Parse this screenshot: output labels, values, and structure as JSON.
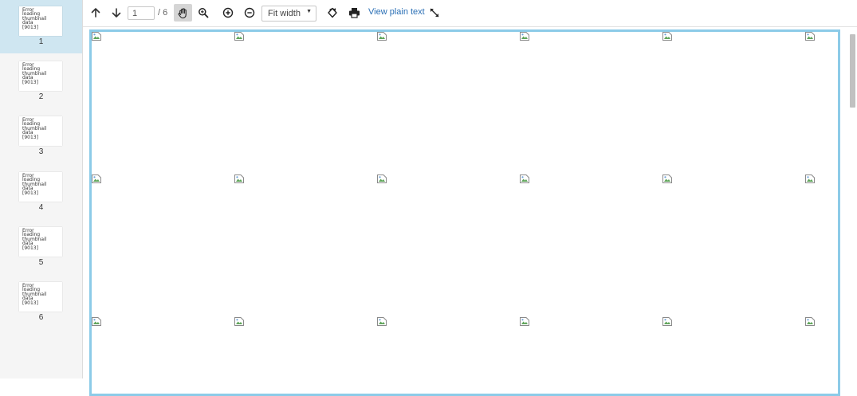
{
  "sidebar": {
    "thumbnails": [
      {
        "number": "1",
        "error_text": "Error loading thumbnail data [9013]",
        "active": true
      },
      {
        "number": "2",
        "error_text": "Error loading thumbnail data [9013]",
        "active": false
      },
      {
        "number": "3",
        "error_text": "Error loading thumbnail data [9013]",
        "active": false
      },
      {
        "number": "4",
        "error_text": "Error loading thumbnail data [9013]",
        "active": false
      },
      {
        "number": "5",
        "error_text": "Error loading thumbnail data [9013]",
        "active": false
      },
      {
        "number": "6",
        "error_text": "Error loading thumbnail data [9013]",
        "active": false
      }
    ]
  },
  "toolbar": {
    "prev_page_icon": "arrow-up-icon",
    "next_page_icon": "arrow-down-icon",
    "current_page": "1",
    "total_pages": "/ 6",
    "pan_tool_icon": "hand-icon",
    "zoom_tool_icon": "magnifier-icon",
    "zoom_in_icon": "plus-circle-icon",
    "zoom_out_icon": "minus-circle-icon",
    "zoom_value": "Fit width",
    "rotate_icon": "rotate-icon",
    "print_icon": "printer-icon",
    "view_plain_text": "View plain text",
    "fullscreen_icon": "expand-icon"
  },
  "colors": {
    "sidebar_bg": "#f5f5f5",
    "active_thumb_bg": "#cfe6f1",
    "page_border": "#8ccbe8",
    "link": "#2a6fb5"
  }
}
